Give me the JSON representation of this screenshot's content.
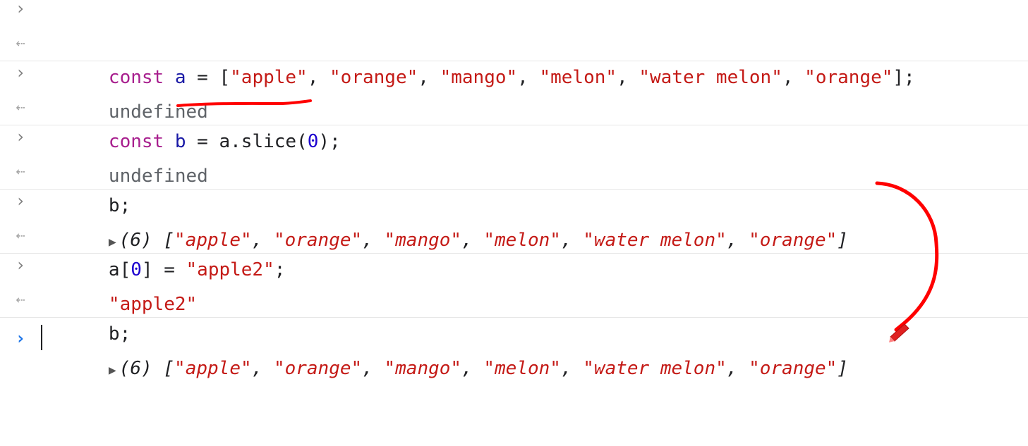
{
  "entries": [
    {
      "input": {
        "kw": "const",
        "var": "a",
        "op": " = ",
        "open": "[",
        "items": [
          "\"apple\"",
          "\"orange\"",
          "\"mango\"",
          "\"melon\"",
          "\"water melon\"",
          "\"orange\""
        ],
        "sep": ", ",
        "close": "];"
      },
      "output": "undefined"
    },
    {
      "input": {
        "kw": "const",
        "var": "b",
        "op": " = ",
        "expr": "a.slice(",
        "num": "0",
        "end": ");"
      },
      "output": "undefined"
    },
    {
      "input": {
        "text": "b;"
      },
      "output": {
        "count": "(6)",
        "open": "[",
        "items": [
          "\"apple\"",
          "\"orange\"",
          "\"mango\"",
          "\"melon\"",
          "\"water melon\"",
          "\"orange\""
        ],
        "sep": ", ",
        "close": "]"
      }
    },
    {
      "input": {
        "pre": "a[",
        "num": "0",
        "mid": "] = ",
        "str": "\"apple2\"",
        "end": ";"
      },
      "output": "\"apple2\""
    },
    {
      "input": {
        "text": "b;"
      },
      "output": {
        "count": "(6)",
        "open": "[",
        "items": [
          "\"apple\"",
          "\"orange\"",
          "\"mango\"",
          "\"melon\"",
          "\"water melon\"",
          "\"orange\""
        ],
        "sep": ", ",
        "close": "]"
      }
    }
  ],
  "icons": {
    "input": "chevron-right-icon",
    "output": "return-arrow-icon",
    "prompt": "prompt-chevron-icon",
    "expand": "expand-triangle-icon"
  },
  "colors": {
    "keyword": "#a81f8e",
    "variable": "#1a1aa6",
    "string": "#c41a16",
    "number": "#1c00cf",
    "annotation": "#ff0000",
    "prompt": "#1a73e8"
  }
}
